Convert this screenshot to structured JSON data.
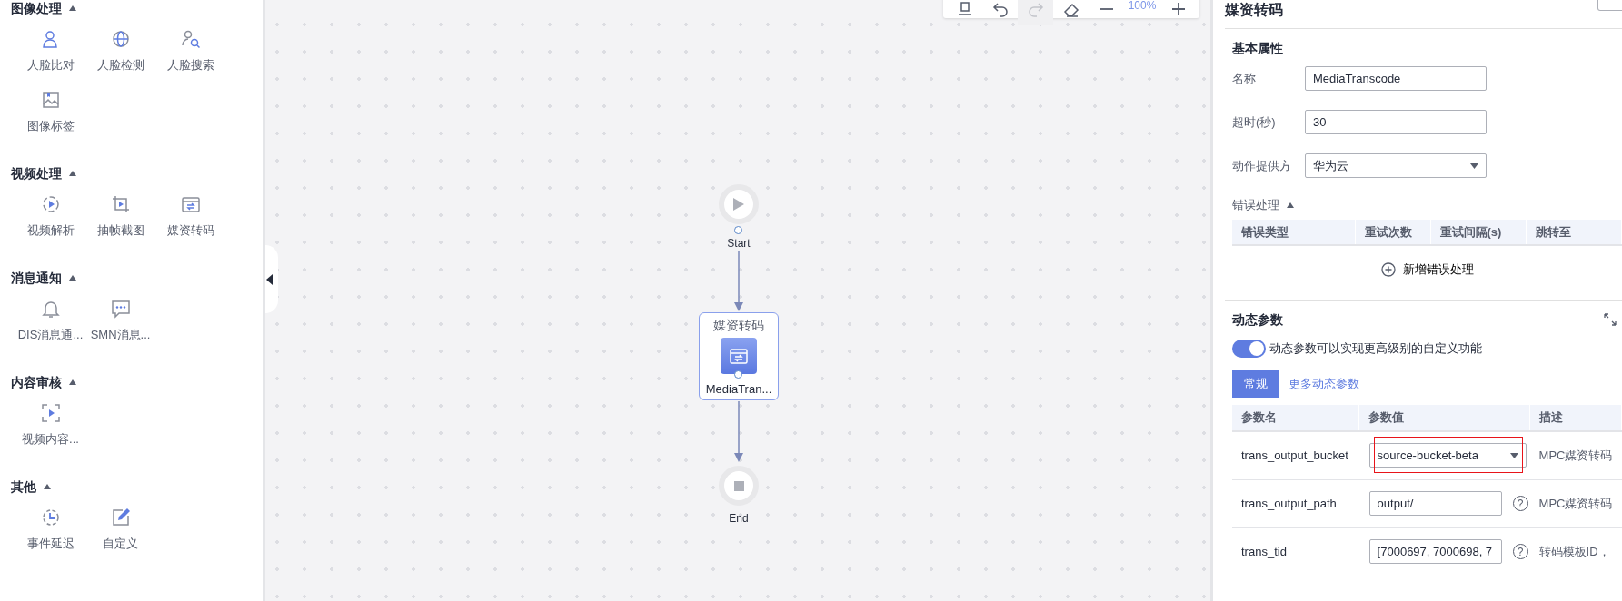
{
  "sidebar": {
    "sections": [
      {
        "title": "图像处理",
        "expanded": true,
        "items": [
          {
            "label": "人脸比对",
            "kind": "person"
          },
          {
            "label": "人脸检测",
            "kind": "globe"
          },
          {
            "label": "人脸搜索",
            "kind": "personsearch"
          },
          {
            "label": "图像标签",
            "kind": "image"
          }
        ]
      },
      {
        "title": "视频处理",
        "expanded": true,
        "items": [
          {
            "label": "视频解析",
            "kind": "playcircle"
          },
          {
            "label": "抽帧截图",
            "kind": "crop"
          },
          {
            "label": "媒资转码",
            "kind": "transcode"
          }
        ]
      },
      {
        "title": "消息通知",
        "expanded": true,
        "items": [
          {
            "label": "DIS消息通...",
            "kind": "bell"
          },
          {
            "label": "SMN消息...",
            "kind": "chat"
          }
        ]
      },
      {
        "title": "内容审核",
        "expanded": true,
        "items": [
          {
            "label": "视频内容...",
            "kind": "scan"
          }
        ]
      },
      {
        "title": "其他",
        "expanded": true,
        "items": [
          {
            "label": "事件延迟",
            "kind": "clock"
          },
          {
            "label": "自定义",
            "kind": "edit"
          }
        ]
      }
    ]
  },
  "toolbar": [
    {
      "kind": "align",
      "disabled": false
    },
    {
      "kind": "undo",
      "disabled": false
    },
    {
      "kind": "redo",
      "disabled": true
    },
    {
      "kind": "eraser",
      "disabled": false
    },
    {
      "kind": "minus",
      "disabled": false
    },
    {
      "kind": "zoom",
      "text": "100%"
    },
    {
      "kind": "plus",
      "disabled": false
    }
  ],
  "flow": {
    "nodes": [
      {
        "kind": "start",
        "label": "Start"
      },
      {
        "kind": "action",
        "title": "媒资转码",
        "label": "MediaTran..."
      },
      {
        "kind": "end",
        "label": "End"
      }
    ]
  },
  "panel": {
    "title": "媒资转码",
    "basic": {
      "heading": "基本属性",
      "fields": [
        {
          "label": "名称",
          "kind": "input",
          "value": "MediaTranscode"
        },
        {
          "label": "超时(秒)",
          "kind": "input",
          "value": "30"
        },
        {
          "label": "动作提供方",
          "kind": "select",
          "value": "华为云"
        }
      ]
    },
    "error_handling": {
      "heading": "错误处理",
      "expanded": true,
      "columns": [
        "错误类型",
        "重试次数",
        "重试间隔(s)",
        "跳转至"
      ],
      "add_label": "新增错误处理"
    },
    "dynamic": {
      "heading": "动态参数",
      "toggle": {
        "on": true,
        "label": "动态参数可以实现更高级别的自定义功能"
      },
      "tabs": [
        {
          "label": "常规",
          "selected": true
        },
        {
          "label": "更多动态参数",
          "selected": false
        }
      ],
      "columns": [
        "参数名",
        "参数值",
        "描述"
      ],
      "rows": [
        {
          "name": "trans_output_bucket",
          "kind": "select",
          "value": "source-bucket-beta",
          "highlighted": true,
          "description": "MPC媒资转码"
        },
        {
          "name": "trans_output_path",
          "kind": "input",
          "value": "output/",
          "help": "?",
          "highlighted": false,
          "description": "MPC媒资转码"
        },
        {
          "name": "trans_tid",
          "kind": "input",
          "value": "[7000697, 7000698, 7",
          "help": "?",
          "highlighted": false,
          "description": "转码模板ID，"
        }
      ]
    }
  }
}
